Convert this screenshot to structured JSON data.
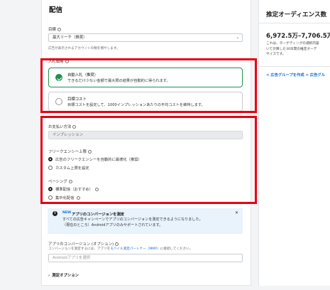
{
  "section": {
    "title": "配信"
  },
  "goal": {
    "label": "目標",
    "value": "最大リーチ（推奨）",
    "help": "広告が表示されるアカウントの数を増やします。"
  },
  "bid_strategy": {
    "label": "入札戦略",
    "options": [
      {
        "title": "自動入札（推奨）",
        "desc": "できるだけ少ない金額で最大限の結果が自動的に得られます。",
        "selected": true
      },
      {
        "title": "目標コスト",
        "desc": "目標コストを設定して、1000インプレッションあたりの平均コストを維持します。",
        "selected": false
      }
    ]
  },
  "payment": {
    "label": "お支払い方法",
    "value": "インプレッション"
  },
  "frequency_cap": {
    "label": "フリークエンシー上限",
    "options": [
      {
        "label": "広告のフリークエンシーを自動的に最適化（推奨）",
        "selected": true
      },
      {
        "label": "カスタム上限を設定",
        "selected": false
      }
    ]
  },
  "pacing": {
    "label": "ペーシング",
    "options": [
      {
        "label": "標準配信（おすすめ）",
        "selected": true
      },
      {
        "label": "集中化配信",
        "selected": false
      }
    ]
  },
  "info_banner": {
    "badge": "NEW",
    "title": "アプリのコンバージョンを測定",
    "line1": "すべての広告キャンペーンでアプリのコンバージョンを測定できるようになりました。",
    "line2": "（現在のところ）Androidアプリのみサポートされています。"
  },
  "app_conversion": {
    "label": "アプリのコンバージョン (オプション)",
    "help_prefix": "コンバージョンを測定するには、アプリを",
    "help_link": "モバイル測定パートナー（MMP）",
    "help_suffix": "に接続してください。",
    "placeholder": "Androidアプリを選択"
  },
  "measurement_options": {
    "label": "測定オプション"
  },
  "right_panel": {
    "title": "推定オーディエンス数",
    "range": "6,972.5万–7,706.5万",
    "desc_line1": "これは、ターゲティングの選択内容",
    "desc_line2": "いて計算した30日間の推定オーデ",
    "desc_line3": "サイズです。",
    "link1": "広告グループを作成",
    "link2": "広告グル"
  },
  "colors": {
    "accent_green": "#1f8f4e",
    "highlight_red": "#e60012",
    "link_blue": "#1a6fd1"
  }
}
